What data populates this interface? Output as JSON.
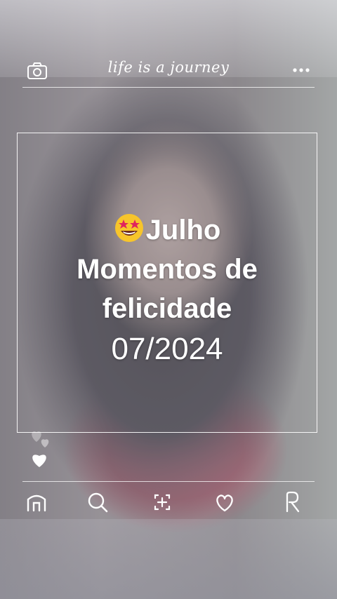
{
  "header": {
    "tagline": "life is a journey",
    "camera_icon": "camera-icon",
    "more_icon": "more-dots-icon"
  },
  "caption": {
    "emoji": "star-struck-emoji",
    "line1": "Julho",
    "line2": "Momentos de",
    "line3": "felicidade",
    "date": "07/2024"
  },
  "reactions": {
    "icon": "heart-icon"
  },
  "nav": {
    "items": [
      {
        "icon": "home-icon"
      },
      {
        "icon": "search-icon"
      },
      {
        "icon": "add-post-icon"
      },
      {
        "icon": "heart-icon"
      },
      {
        "icon": "profile-icon"
      }
    ]
  },
  "colors": {
    "overlay_text": "#ffffff",
    "shirt": "#b64d63"
  }
}
